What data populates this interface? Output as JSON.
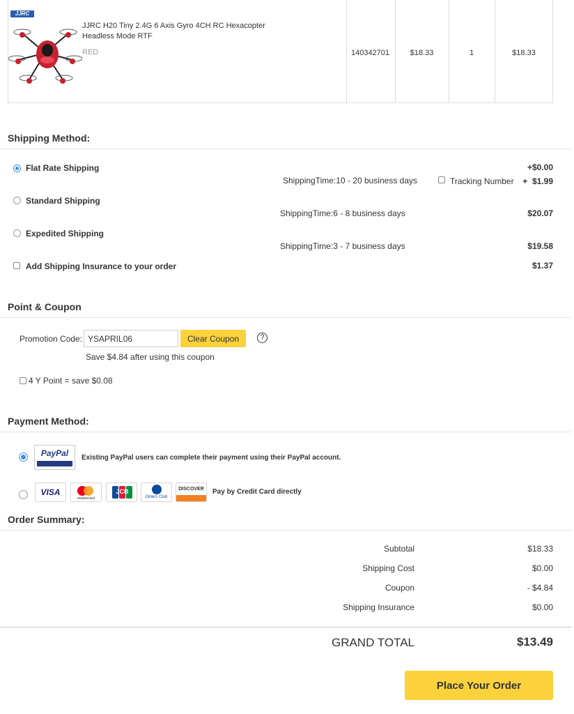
{
  "product": {
    "brand": "JJRC",
    "name_line1": "JJRC H20 Tiny 2.4G 6 Axis Gyro 4CH RC Hexacopter",
    "name_line2": "Headless Mode RTF",
    "color": "RED",
    "sku": "140342701",
    "price": "$18.33",
    "qty": "1",
    "total": "$18.33"
  },
  "shipping": {
    "title": "Shipping Method:",
    "options": [
      {
        "label": "Flat Rate Shipping",
        "time": "ShippingTime:10 - 20 business days",
        "price": "+$0.00",
        "selected": true
      },
      {
        "label": "Standard Shipping",
        "time": "ShippingTime:6 - 8 business days",
        "price": "$20.07",
        "selected": false
      },
      {
        "label": "Expedited Shipping",
        "time": "ShippingTime:3 - 7 business days",
        "price": "$19.58",
        "selected": false
      }
    ],
    "tracking_label": "Tracking Number",
    "tracking_price": "+  $1.99",
    "insurance_label": "Add Shipping Insurance to your order",
    "insurance_price": "$1.37"
  },
  "coupon": {
    "title": "Point & Coupon",
    "promo_label": "Promotion Code:",
    "promo_value": "YSAPRIL06",
    "clear_button": "Clear Coupon",
    "help": "?",
    "save_text": "Save $4.84 after using this coupon",
    "points_label": "4 Y Point = save $0.08"
  },
  "payment": {
    "title": "Payment Method:",
    "paypal_logo": "PayPal",
    "paypal_text": "Existing PayPal users can complete their payment using their PayPal account.",
    "cards": [
      "VISA",
      "mastercard",
      "JCB",
      "Diners Club",
      "DISCOVER"
    ],
    "card_text": "Pay by Credit Card directly"
  },
  "summary": {
    "title": "Order Summary:",
    "rows": [
      {
        "label": "Subtotal",
        "value": "$18.33"
      },
      {
        "label": "Shipping Cost",
        "value": "$0.00"
      },
      {
        "label": "Coupon",
        "value": "- $4.84"
      },
      {
        "label": "Shipping Insurance",
        "value": "$0.00"
      }
    ],
    "grand_label": "GRAND TOTAL",
    "grand_value": "$13.49"
  },
  "place_order": "Place Your Order",
  "colors": {
    "accent_yellow": "#fbd23c",
    "radio_blue": "#3b8fe5",
    "paypal_blue": "#253b80",
    "drone_red": "#c8202f"
  },
  "icons": [
    "drone-product-image",
    "jjrc-logo",
    "help-icon",
    "paypal-logo",
    "visa-logo",
    "mastercard-logo",
    "jcb-logo",
    "diners-club-logo",
    "discover-logo"
  ]
}
